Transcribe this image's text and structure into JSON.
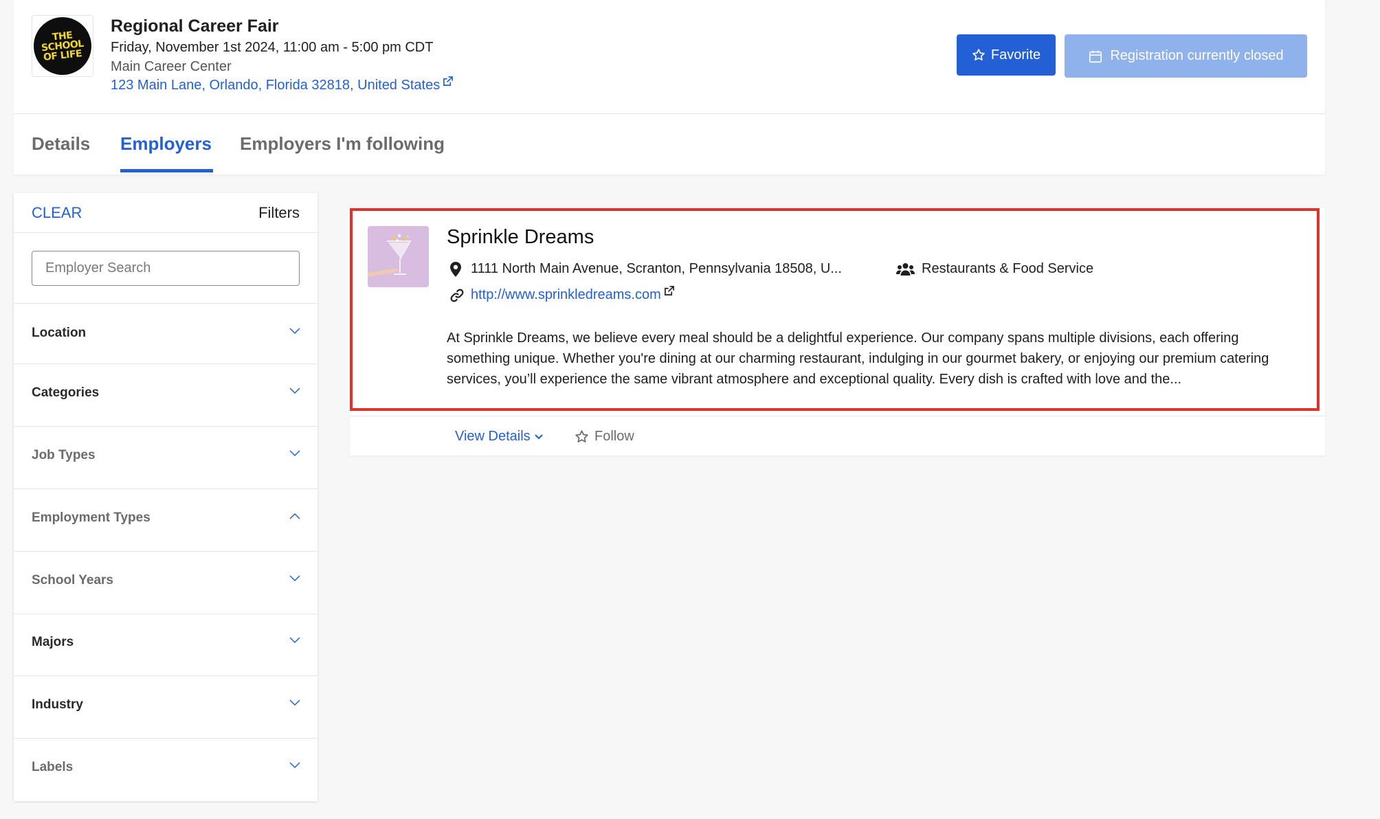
{
  "event": {
    "title": "Regional Career Fair",
    "date_time": "Friday, November 1st 2024, 11:00 am - 5:00 pm CDT",
    "venue": "Main Career Center",
    "address": "123 Main Lane, Orlando, Florida 32818, United States",
    "logo_lines": [
      "THE",
      "SCHOOL",
      "OF LIFE"
    ]
  },
  "actions": {
    "favorite_label": "Favorite",
    "registration_label": "Registration currently closed"
  },
  "tabs": [
    {
      "label": "Details",
      "active": false
    },
    {
      "label": "Employers",
      "active": true
    },
    {
      "label": "Employers I'm following",
      "active": false
    }
  ],
  "sidebar": {
    "clear_label": "CLEAR",
    "filters_label": "Filters",
    "search_placeholder": "Employer Search",
    "sections": [
      {
        "label": "Location",
        "expanded": false
      },
      {
        "label": "Categories",
        "expanded": false
      },
      {
        "label": "Job Types",
        "expanded": false
      },
      {
        "label": "Employment Types",
        "expanded": true
      },
      {
        "label": "School Years",
        "expanded": false
      },
      {
        "label": "Majors",
        "expanded": false
      },
      {
        "label": "Industry",
        "expanded": false
      },
      {
        "label": "Labels",
        "expanded": false
      }
    ]
  },
  "employer": {
    "name": "Sprinkle Dreams",
    "location": "1111 North Main Avenue, Scranton, Pennsylvania 18508, U...",
    "industry": "Restaurants & Food Service",
    "website": "http://www.sprinkledreams.com",
    "description": "At Sprinkle Dreams, we believe every meal should be a delightful experience. Our company spans multiple divisions, each offering something unique. Whether you're dining at our charming restaurant, indulging in our gourmet bakery, or enjoying our premium catering services, you’ll experience the same vibrant atmosphere and exceptional quality. Every dish is crafted with love and the...",
    "view_details_label": "View Details",
    "follow_label": "Follow"
  },
  "colors": {
    "primary": "#2360d6",
    "disabled_primary": "#8fb1ec",
    "highlight": "#e0322a"
  }
}
